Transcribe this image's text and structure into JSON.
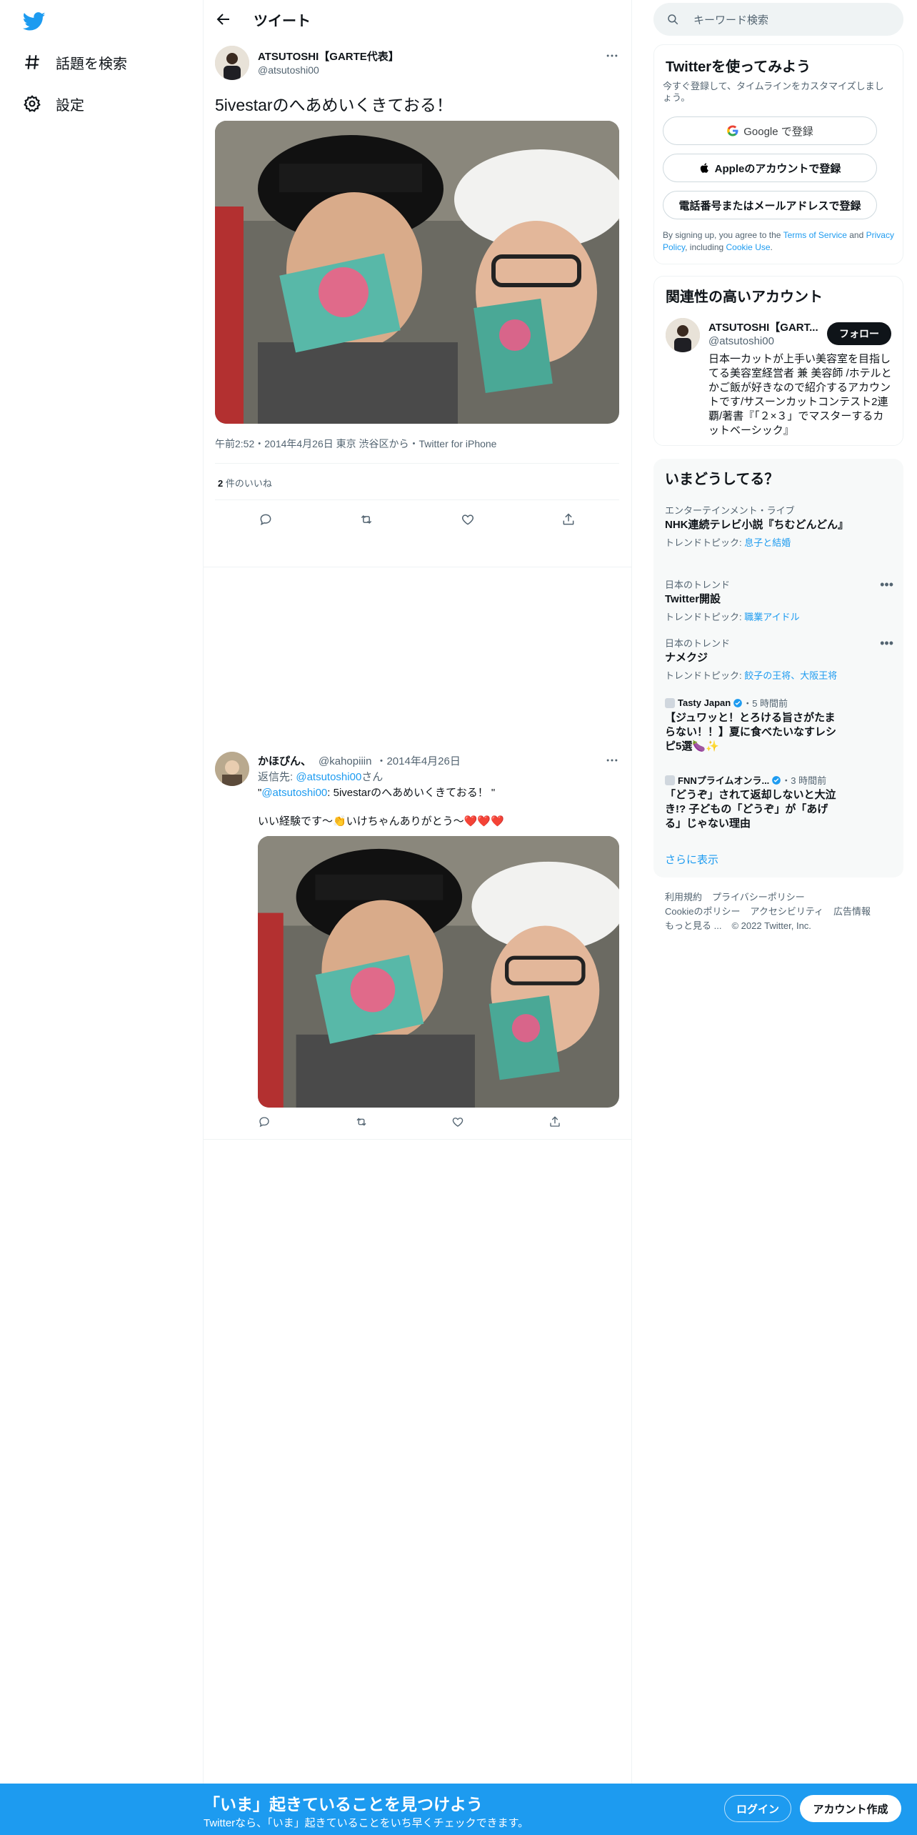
{
  "nav": {
    "explore_label": "話題を検索",
    "settings_label": "設定"
  },
  "header": {
    "title": "ツイート"
  },
  "main_tweet": {
    "name": "ATSUTOSHI【GARTE代表】",
    "handle": "@atsutoshi00",
    "text": "5ivestarのへあめいくきておる！",
    "meta": "午前2:52・2014年4月26日 東京 渋谷区から・Twitter for iPhone",
    "likes_count": "2",
    "likes_label": "件のいいね"
  },
  "reply": {
    "name": "かほぴん、",
    "handle": "@kahopiiin",
    "date": "・2014年4月26日",
    "reply_to_prefix": "返信先: ",
    "reply_to_handle": "@atsutoshi00",
    "reply_to_suffix": "さん",
    "quote_open": "\"",
    "quote_handle": "@atsutoshi00",
    "quote_text": ": 5ivestarのへあめいくきておる！ \"",
    "body": "いい経験です〜👏いけちゃんありがとう〜❤️❤️❤️"
  },
  "search": {
    "placeholder": "キーワード検索"
  },
  "signup_card": {
    "title": "Twitterを使ってみよう",
    "subtitle": "今すぐ登録して、タイムラインをカスタマイズしましょう。",
    "google_label": "Google で登録",
    "apple_label": "Appleのアカウントで登録",
    "phone_label": "電話番号またはメールアドレスで登録",
    "legal_prefix": "By signing up, you agree to the ",
    "tos": "Terms of Service",
    "and": " and ",
    "privacy": "Privacy Policy",
    "including": ", including ",
    "cookie": "Cookie Use",
    "period": "."
  },
  "related": {
    "title": "関連性の高いアカウント",
    "name": "ATSUTOSHI【GART...",
    "handle": "@atsutoshi00",
    "follow_label": "フォロー",
    "bio": "日本一カットが上手い美容室を目指してる美容室経営者 兼 美容師 /ホテルとかご飯が好きなので紹介するアカウントです/サスーンカットコンテスト2連覇/著書『「２×３」でマスターするカットベーシック』"
  },
  "trends": {
    "title": "いまどうしてる？",
    "items": [
      {
        "cat": "エンターテインメント・ライブ",
        "title": "NHK連続テレビ小説『ちむどんどん』",
        "sub_prefix": "トレンドトピック: ",
        "sub_link": "息子と結婚"
      },
      {
        "cat": "日本のトレンド",
        "title": "Twitter開設",
        "sub_prefix": "トレンドトピック: ",
        "sub_link": "職業アイドル"
      },
      {
        "cat": "日本のトレンド",
        "title": "ナメクジ",
        "sub_prefix": "トレンドトピック: ",
        "sub_link": "餃子の王将、大阪王将"
      },
      {
        "source": "Tasty Japan",
        "time": "・5 時間前",
        "title": "【ジュワッと！とろける旨さがたまらない！！】夏に食べたいなすレシピ5選🍆✨"
      },
      {
        "source": "FNNプライムオンラ...",
        "time": "・3 時間前",
        "title": "「どうぞ」されて返却しないと大泣き!? 子どもの「どうぞ」が「あげる」じゃない理由"
      }
    ],
    "show_more": "さらに表示"
  },
  "footer": {
    "links": [
      "利用規約",
      "プライバシーポリシー",
      "Cookieのポリシー",
      "アクセシビリティ",
      "広告情報",
      "もっと見る ...",
      "© 2022 Twitter, Inc."
    ]
  },
  "bottom_bar": {
    "heading": "「いま」起きていることを見つけよう",
    "sub": "Twitterなら、「いま」起きていることをいち早くチェックできます。",
    "login_label": "ログイン",
    "signup_label": "アカウント作成"
  },
  "colors": {
    "accent": "#1d9bf0",
    "text": "#0f1419",
    "muted": "#536471"
  }
}
